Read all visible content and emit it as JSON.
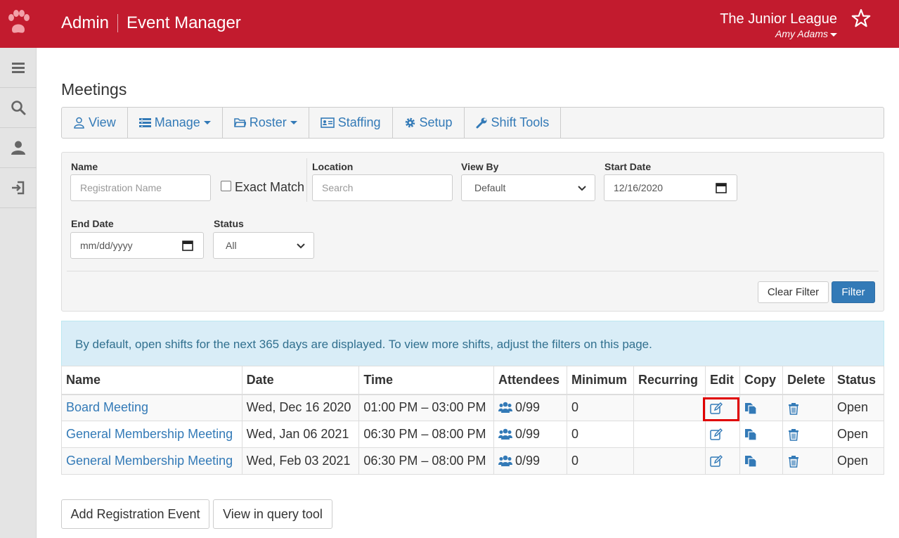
{
  "header": {
    "brand_admin": "Admin",
    "brand_app": "Event Manager",
    "org_name": "The Junior League",
    "user_name": "Amy Adams"
  },
  "sidebar": {
    "items": [
      {
        "icon": "menu-icon"
      },
      {
        "icon": "search-icon"
      },
      {
        "icon": "user-icon"
      },
      {
        "icon": "logout-icon"
      }
    ]
  },
  "page": {
    "title": "Meetings"
  },
  "toolbar": {
    "items": [
      {
        "label": "View",
        "icon": "user-outline-icon"
      },
      {
        "label": "Manage",
        "icon": "list-icon"
      },
      {
        "label": "Roster",
        "icon": "folder-icon"
      },
      {
        "label": "Staffing",
        "icon": "id-card-icon"
      },
      {
        "label": "Setup",
        "icon": "gear-icon"
      },
      {
        "label": "Shift Tools",
        "icon": "wrench-icon"
      }
    ]
  },
  "filters": {
    "name_label": "Name",
    "name_placeholder": "Registration Name",
    "exact_match_label": "Exact Match",
    "location_label": "Location",
    "location_placeholder": "Search",
    "view_by_label": "View By",
    "view_by_value": "Default",
    "start_date_label": "Start Date",
    "start_date_value": "12/16/2020",
    "end_date_label": "End Date",
    "end_date_value": "mm/dd/yyyy",
    "status_label": "Status",
    "status_value": "All",
    "clear_button": "Clear Filter",
    "filter_button": "Filter"
  },
  "info_message": "By default, open shifts for the next 365 days are displayed. To view more shifts, adjust the filters on this page.",
  "table": {
    "columns": [
      "Name",
      "Date",
      "Time",
      "Attendees",
      "Minimum",
      "Recurring",
      "Edit",
      "Copy",
      "Delete",
      "Status"
    ],
    "rows": [
      {
        "name": "Board Meeting",
        "date": "Wed, Dec 16 2020",
        "time": "01:00 PM – 03:00 PM",
        "attendees": "0/99",
        "minimum": "0",
        "recurring": "",
        "status": "Open"
      },
      {
        "name": "General Membership Meeting",
        "date": "Wed, Jan 06 2021",
        "time": "06:30 PM – 08:00 PM",
        "attendees": "0/99",
        "minimum": "0",
        "recurring": "",
        "status": "Open"
      },
      {
        "name": "General Membership Meeting",
        "date": "Wed, Feb 03 2021",
        "time": "06:30 PM – 08:00 PM",
        "attendees": "0/99",
        "minimum": "0",
        "recurring": "",
        "status": "Open"
      }
    ]
  },
  "actions": {
    "add_event": "Add Registration Event",
    "query_tool": "View in query tool"
  },
  "colors": {
    "brand": "#c21b2e",
    "link": "#337ab7",
    "highlight": "#e00000"
  }
}
